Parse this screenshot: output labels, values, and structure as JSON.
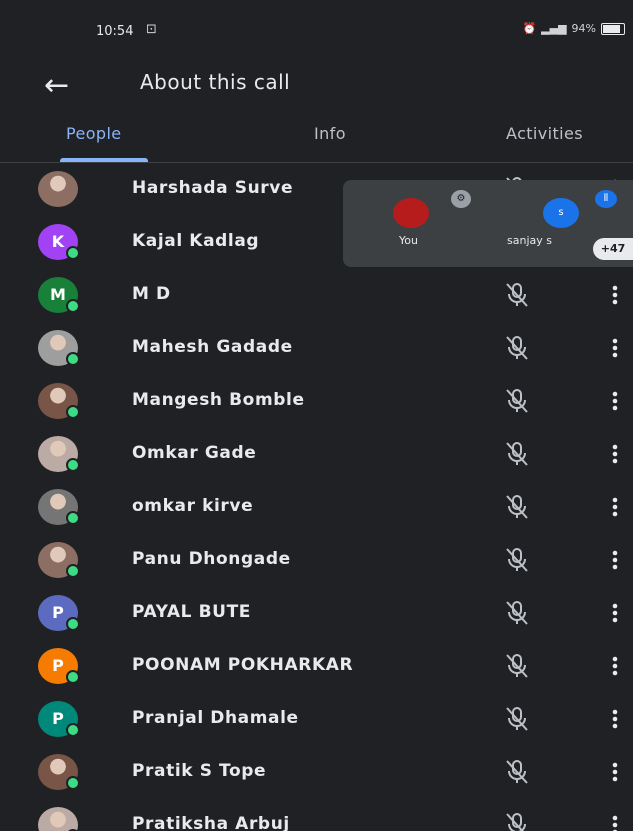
{
  "status_bar": {
    "time": "10:54",
    "right_text": "94%"
  },
  "header": {
    "title": "About this call"
  },
  "tabs": [
    {
      "label": "People",
      "active": true
    },
    {
      "label": "Info",
      "active": false
    },
    {
      "label": "Activities",
      "active": false
    }
  ],
  "participants": [
    {
      "name": "Harshada Surve",
      "avatar": "photo",
      "muted": true
    },
    {
      "name": "Kajal Kadlag",
      "avatar": "K",
      "color": "#a142f4",
      "muted": true
    },
    {
      "name": "M D",
      "avatar": "M",
      "color": "#188038",
      "muted": true
    },
    {
      "name": "Mahesh Gadade",
      "avatar": "photo",
      "muted": true
    },
    {
      "name": "Mangesh Bomble",
      "avatar": "photo",
      "muted": true
    },
    {
      "name": "Omkar Gade",
      "avatar": "photo",
      "muted": true
    },
    {
      "name": "omkar kirve",
      "avatar": "photo",
      "muted": true
    },
    {
      "name": "Panu Dhongade",
      "avatar": "photo",
      "muted": true
    },
    {
      "name": "PAYAL BUTE",
      "avatar": "P",
      "color": "#5c6bc0",
      "muted": true
    },
    {
      "name": "POONAM POKHARKAR",
      "avatar": "P",
      "color": "#f57c00",
      "muted": true
    },
    {
      "name": "Pranjal Dhamale",
      "avatar": "P",
      "color": "#00897b",
      "muted": true
    },
    {
      "name": "Pratik S Tope",
      "avatar": "photo",
      "muted": true
    },
    {
      "name": "Pratiksha Arbuj",
      "avatar": "photo",
      "muted": true
    }
  ],
  "floating_panel": {
    "you_label": "You",
    "other_label": "sanjay s",
    "other_initial": "s",
    "overflow_count": "+47"
  },
  "icons": {
    "back": "arrow-back-icon",
    "mic_off": "mic-off-icon",
    "more": "more-vert-icon"
  }
}
